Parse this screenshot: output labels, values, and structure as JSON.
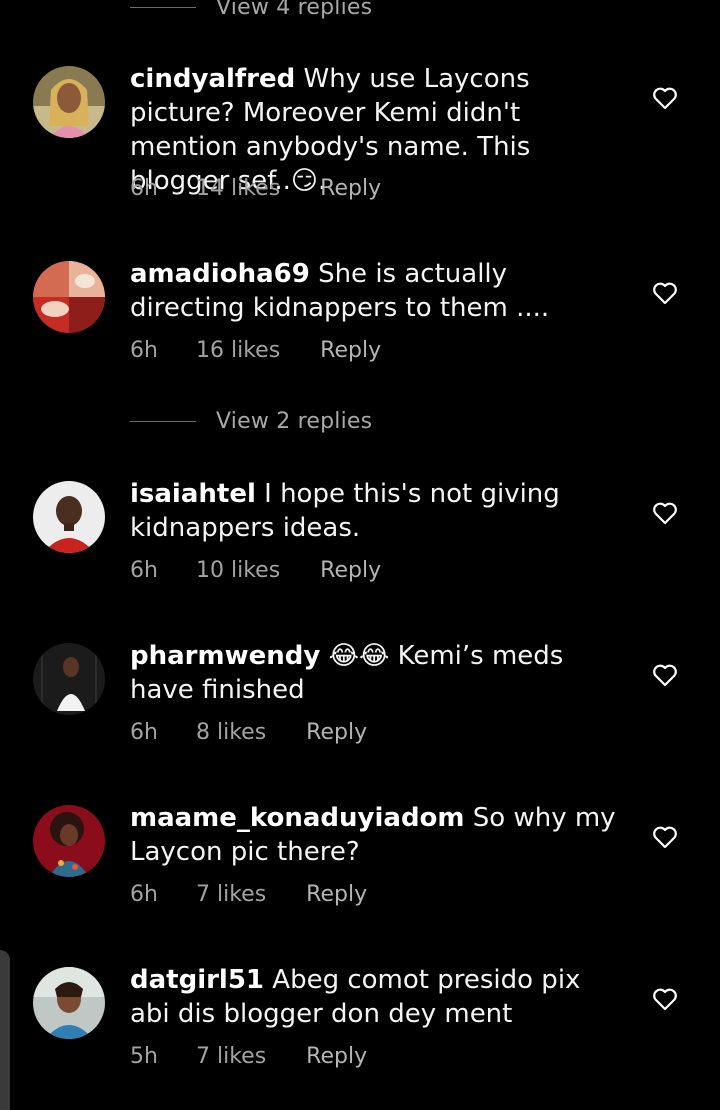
{
  "top_view_replies": "View 4 replies",
  "mid_view_replies": "View 2 replies",
  "comments": [
    {
      "username": "cindyalfred",
      "text": "Why use Laycons picture? Moreover Kemi didn't mention anybody's name. This blogger sef..😏.",
      "time": "6h",
      "likes": "14 likes",
      "reply": "Reply",
      "avatar": "woman-portrait-avatar",
      "heart_icon": "heart-outline-icon"
    },
    {
      "username": "amadioha69",
      "text": "She is actually directing kidnappers to them ....",
      "time": "6h",
      "likes": "16 likes",
      "reply": "Reply",
      "avatar": "collage-avatar",
      "heart_icon": "heart-outline-icon"
    },
    {
      "username": "isaiahtel",
      "text": "I hope this's not giving kidnappers ideas.",
      "time": "6h",
      "likes": "10 likes",
      "reply": "Reply",
      "avatar": "man-portrait-avatar",
      "heart_icon": "heart-outline-icon"
    },
    {
      "username": "pharmwendy",
      "text": "😂😂 Kemi’s meds have finished",
      "time": "6h",
      "likes": "8 likes",
      "reply": "Reply",
      "avatar": "woman-white-dress-avatar",
      "heart_icon": "heart-outline-icon"
    },
    {
      "username": "maame_konaduyiadom",
      "text": "So why my Laycon pic there?",
      "time": "6h",
      "likes": "7 likes",
      "reply": "Reply",
      "avatar": "woman-afro-avatar",
      "heart_icon": "heart-outline-icon"
    },
    {
      "username": "datgirl51",
      "text": "Abeg comot presido pix abi dis blogger don dey ment",
      "time": "5h",
      "likes": "7 likes",
      "reply": "Reply",
      "avatar": "woman-selfie-avatar",
      "heart_icon": "heart-outline-icon"
    }
  ]
}
